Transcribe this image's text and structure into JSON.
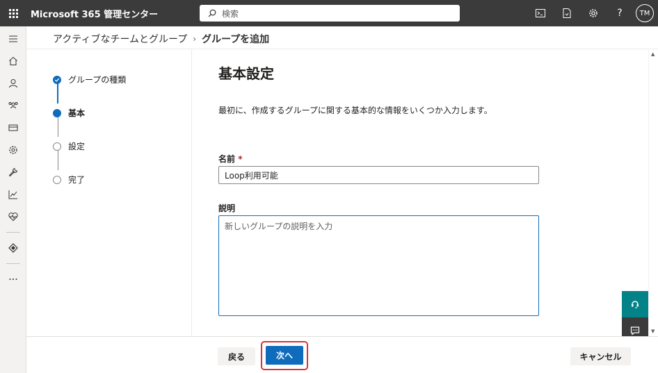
{
  "header": {
    "app_title": "Microsoft 365 管理センター",
    "search_placeholder": "検索",
    "avatar_initials": "TM",
    "help_label": "?"
  },
  "breadcrumb": {
    "parent": "アクティブなチームとグループ",
    "current": "グループを追加"
  },
  "steps": [
    {
      "label": "グループの種類",
      "state": "done"
    },
    {
      "label": "基本",
      "state": "current"
    },
    {
      "label": "設定",
      "state": "todo"
    },
    {
      "label": "完了",
      "state": "todo"
    }
  ],
  "form": {
    "title": "基本設定",
    "description": "最初に、作成するグループに関する基本的な情報をいくつか入力します。",
    "name_label": "名前",
    "name_required_mark": "*",
    "name_value": "Loop利用可能",
    "description_label": "説明",
    "description_placeholder": "新しいグループの説明を入力"
  },
  "buttons": {
    "back": "戻る",
    "next": "次へ",
    "cancel": "キャンセル"
  },
  "colors": {
    "topbar": "#3b3b3b",
    "accent": "#0f6cbd",
    "highlight": "#e03131",
    "help_teal": "#038387"
  }
}
